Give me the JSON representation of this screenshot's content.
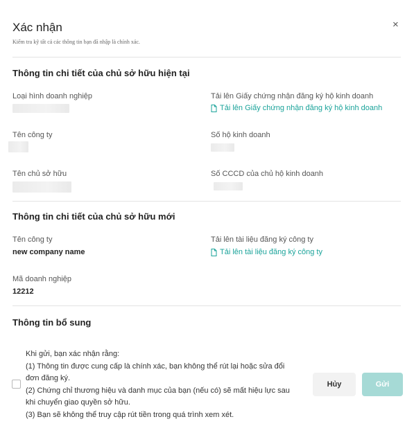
{
  "dialog": {
    "title": "Xác nhận",
    "subtitle": "Kiểm tra kỹ tất cả các thông tin bạn đã nhập là chính xác.",
    "close_symbol": "×"
  },
  "current_owner": {
    "heading": "Thông tin chi tiết của chủ sở hữu hiện tại",
    "business_type_label": "Loại hình doanh nghiệp",
    "upload_certificate_label": "Tải lên Giấy chứng nhận đăng ký hộ kinh doanh",
    "upload_certificate_link": "Tải lên Giấy chứng nhận đăng ký hộ kinh doanh",
    "company_name_label": "Tên công ty",
    "business_number_label": "Số hộ kinh doanh",
    "owner_name_label": "Tên chủ sở hữu",
    "owner_id_label": "Số CCCD của chủ hộ kinh doanh"
  },
  "new_owner": {
    "heading": "Thông tin chi tiết của chủ sở hữu mới",
    "company_name_label": "Tên công ty",
    "company_name_value": "new company name",
    "upload_docs_label": "Tải lên tài liệu đăng ký công ty",
    "upload_docs_link": "Tải lên tài liệu đăng ký công ty",
    "business_code_label": "Mã doanh nghiệp",
    "business_code_value": "12212"
  },
  "additional": {
    "heading": "Thông tin bổ sung",
    "consent_lines": [
      "Khi gửi, bạn xác nhận rằng:",
      "(1) Thông tin được cung cấp là chính xác, bạn không thể rút lại hoặc sửa đổi",
      "đơn đăng ký.",
      "(2) Chứng chỉ thương hiệu và danh mục của bạn (nếu có) sẽ mất hiệu lực sau",
      "khi chuyển giao quyền sở hữu.",
      "(3) Bạn sẽ không thể truy cập rút tiền trong quá trình xem xét."
    ],
    "consent_checked": false
  },
  "actions": {
    "cancel_label": "Hủy",
    "submit_label": "Gửi"
  },
  "colors": {
    "link": "#1aa39a",
    "submit_disabled": "#a6dad6",
    "cancel_bg": "#f2f2f2"
  },
  "icons": {
    "close": "close-icon",
    "document": "document-icon"
  }
}
